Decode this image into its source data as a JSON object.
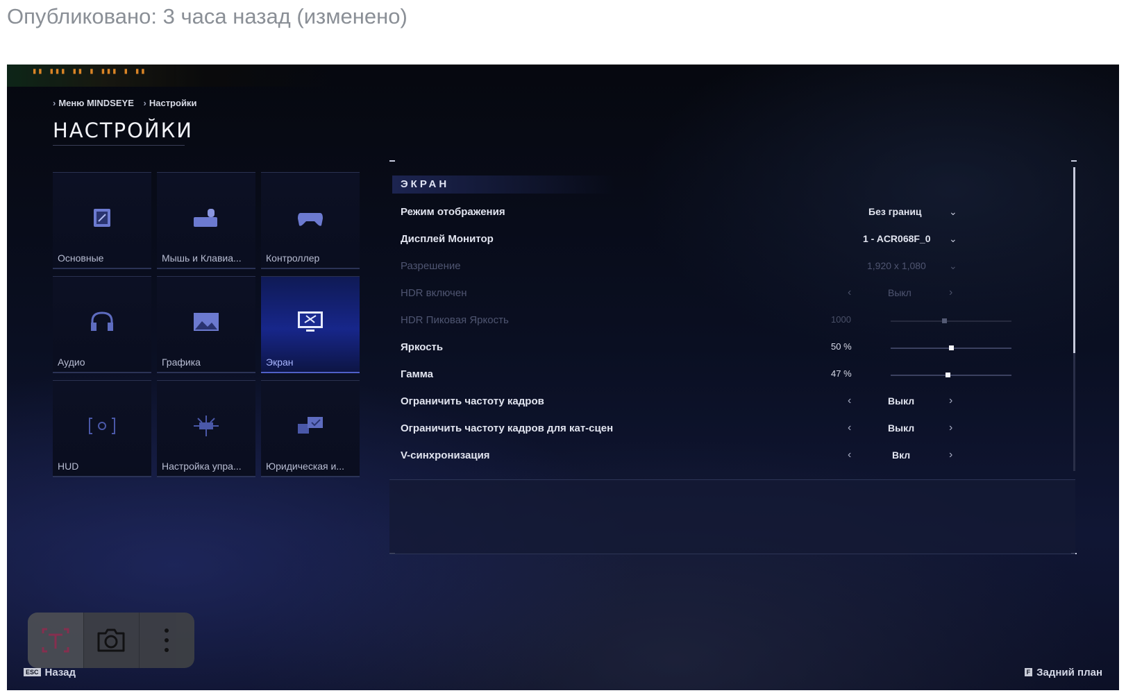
{
  "post": {
    "meta": "Опубликовано: 3 часа назад (изменено)"
  },
  "overlay": {
    "fps_text": "▮▮ ▮▮▮ ▮▮ ▮ ▮▮▮ ▮ ▮▮"
  },
  "breadcrumb": {
    "item1": "Меню MINDSEYE",
    "item2": "Настройки"
  },
  "page": {
    "title": "НАСТРОЙКИ"
  },
  "categories": [
    {
      "label": "Основные",
      "icon": "chip-icon"
    },
    {
      "label": "Мышь и Клавиа...",
      "icon": "keyboard-mouse-icon"
    },
    {
      "label": "Контроллер",
      "icon": "gamepad-icon"
    },
    {
      "label": "Аудио",
      "icon": "headphones-icon"
    },
    {
      "label": "Графика",
      "icon": "image-icon"
    },
    {
      "label": "Экран",
      "icon": "display-icon",
      "active": true
    },
    {
      "label": "HUD",
      "icon": "hud-icon"
    },
    {
      "label": "Настройка упра...",
      "icon": "network-icon"
    },
    {
      "label": "Юридическая и...",
      "icon": "legal-icon"
    }
  ],
  "section": {
    "title": "ЭКРАН"
  },
  "settings": {
    "display_mode": {
      "label": "Режим отображения",
      "value": "Без границ"
    },
    "display_monitor": {
      "label": "Дисплей Монитор",
      "value": "1 - ACR068F_0"
    },
    "resolution": {
      "label": "Разрешение",
      "value": "1,920 x 1,080"
    },
    "hdr_enabled": {
      "label": "HDR включен",
      "value": "Выкл"
    },
    "hdr_peak": {
      "label": "HDR Пиковая Яркость",
      "value": "1000",
      "fraction": 0.44
    },
    "brightness": {
      "label": "Яркость",
      "value": "50 %",
      "fraction": 0.5
    },
    "gamma": {
      "label": "Гамма",
      "value": "47 %",
      "fraction": 0.47
    },
    "frame_limit": {
      "label": "Ограничить частоту кадров",
      "value": "Выкл"
    },
    "frame_limit_cutscenes": {
      "label": "Ограничить частоту кадров для кат-сцен",
      "value": "Выкл"
    },
    "vsync": {
      "label": "V-синхронизация",
      "value": "Вкл"
    }
  },
  "footer": {
    "back_key": "ESC",
    "back_label": "Назад",
    "bg_key": "F",
    "bg_label": "Задний план"
  },
  "toolbar": {
    "items": [
      "text-select-icon",
      "camera-icon",
      "more-vertical-icon"
    ]
  },
  "colors": {
    "accent": "#5060c8",
    "background": "#0a0f22",
    "text": "#e2e5f0",
    "dim_text": "#4f5571"
  }
}
